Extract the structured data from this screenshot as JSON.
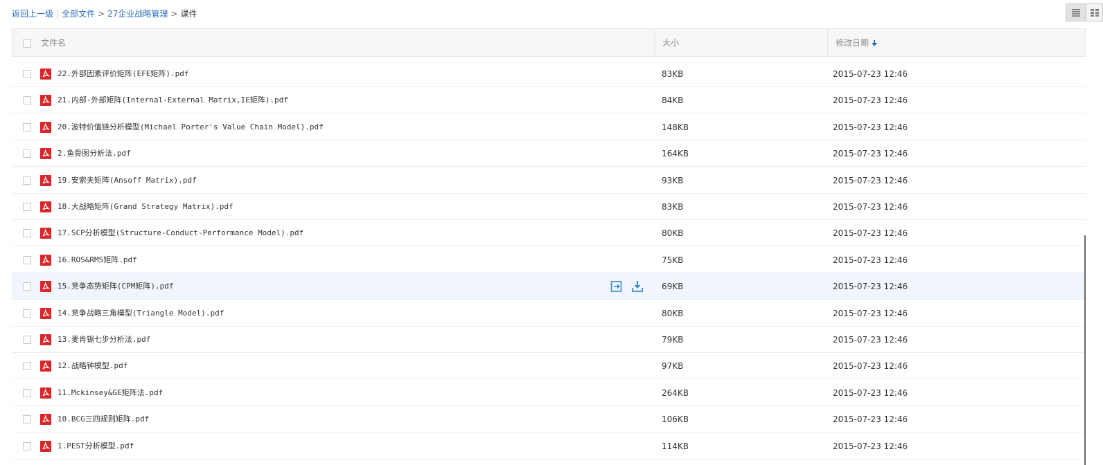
{
  "breadcrumb": {
    "back": "返回上一级",
    "all_files": "全部文件",
    "folder": "27企业战略管理",
    "current": "课件"
  },
  "header": {
    "name": "文件名",
    "size": "大小",
    "date": "修改日期"
  },
  "files": [
    {
      "name": "22.外部因素评价矩阵(EFE矩阵).pdf",
      "size": "83KB",
      "date": "2015-07-23 12:46"
    },
    {
      "name": "21.内部-外部矩阵(Internal-External Matrix,IE矩阵).pdf",
      "size": "84KB",
      "date": "2015-07-23 12:46"
    },
    {
      "name": "20.波特价值链分析模型(Michael Porter's Value Chain Model).pdf",
      "size": "148KB",
      "date": "2015-07-23 12:46"
    },
    {
      "name": "2.鱼骨图分析法.pdf",
      "size": "164KB",
      "date": "2015-07-23 12:46"
    },
    {
      "name": "19.安索夫矩阵(Ansoff Matrix).pdf",
      "size": "93KB",
      "date": "2015-07-23 12:46"
    },
    {
      "name": "18.大战略矩阵(Grand Strategy Matrix).pdf",
      "size": "83KB",
      "date": "2015-07-23 12:46"
    },
    {
      "name": "17.SCP分析模型(Structure-Conduct-Performance Model).pdf",
      "size": "80KB",
      "date": "2015-07-23 12:46"
    },
    {
      "name": "16.ROS&RMS矩阵.pdf",
      "size": "75KB",
      "date": "2015-07-23 12:46"
    },
    {
      "name": "15.竞争态势矩阵(CPM矩阵).pdf",
      "size": "69KB",
      "date": "2015-07-23 12:46",
      "hover": true
    },
    {
      "name": "14.竞争战略三角模型(Triangle Model).pdf",
      "size": "80KB",
      "date": "2015-07-23 12:46"
    },
    {
      "name": "13.麦肯锡七步分析法.pdf",
      "size": "79KB",
      "date": "2015-07-23 12:46"
    },
    {
      "name": "12.战略钟模型.pdf",
      "size": "97KB",
      "date": "2015-07-23 12:46"
    },
    {
      "name": "11.Mckinsey&GE矩阵法.pdf",
      "size": "264KB",
      "date": "2015-07-23 12:46"
    },
    {
      "name": "10.BCG三四规则矩阵.pdf",
      "size": "106KB",
      "date": "2015-07-23 12:46"
    },
    {
      "name": "1.PEST分析模型.pdf",
      "size": "114KB",
      "date": "2015-07-23 12:46"
    }
  ],
  "icons": {
    "file_type": "pdf-icon",
    "sort": "arrow-down-icon",
    "list_view": "list-view-icon",
    "grid_view": "grid-view-icon",
    "share": "share-icon",
    "download": "download-icon"
  },
  "colors": {
    "link": "#2b6dbf",
    "pdf_red": "#d8262c",
    "hover_row": "#f1f6fd",
    "action_blue": "#3d8ad8"
  }
}
